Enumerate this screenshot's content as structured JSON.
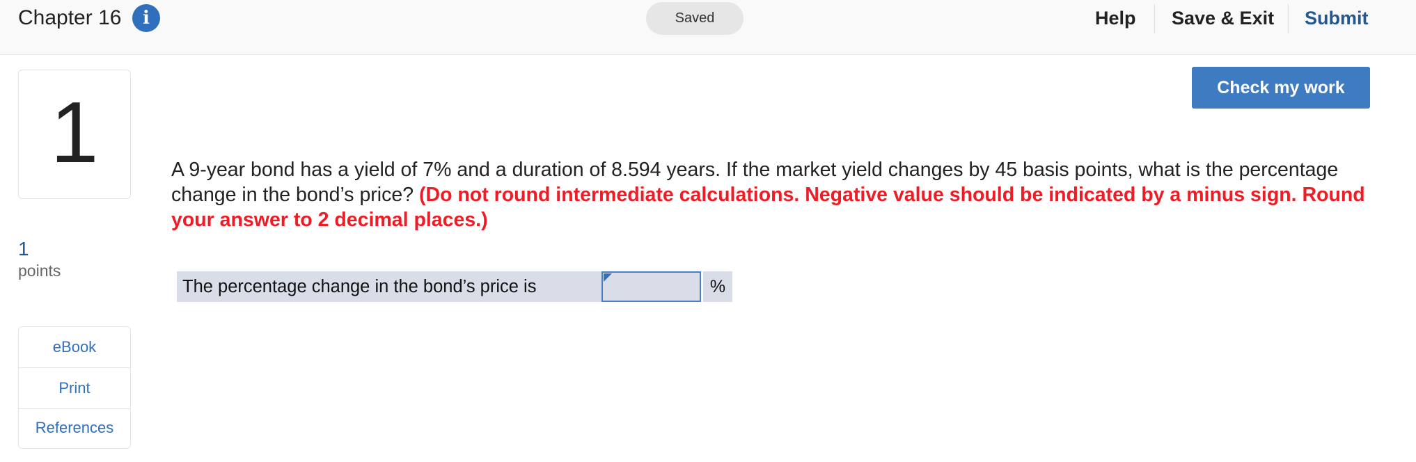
{
  "header": {
    "chapter_title": "Chapter 16",
    "info_icon": "info-icon",
    "status": "Saved",
    "links": {
      "help": "Help",
      "save_exit": "Save & Exit",
      "submit": "Submit"
    }
  },
  "question": {
    "number": "1",
    "points_value": "1",
    "points_label": "points",
    "text": "A 9-year bond has a yield of 7% and a duration of 8.594 years. If the market yield changes by 45 basis points, what is the percentage change in the bond’s price? ",
    "instructions": "(Do not round intermediate calculations. Negative value should be indicated by a minus sign. Round your answer to 2 decimal places.)",
    "check_button": "Check my work"
  },
  "tools": [
    "eBook",
    "Print",
    "References"
  ],
  "answer": {
    "label": "The percentage change in the bond’s price is",
    "value": "",
    "unit": "%"
  },
  "colors": {
    "accent": "#3f7bc0",
    "link": "#24578f",
    "instruction": "#ee1c25",
    "answer_bg": "#d9dde8"
  }
}
